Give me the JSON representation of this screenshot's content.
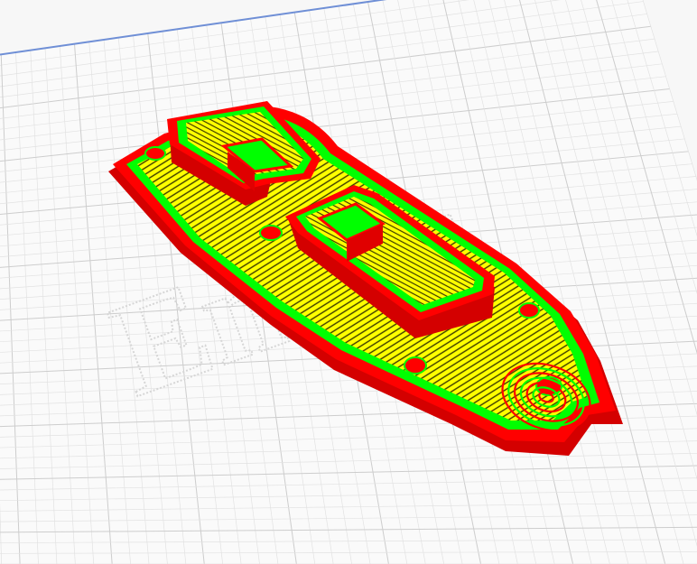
{
  "viewport": {
    "watermark_text": "Ender",
    "background": "#f7f7f7",
    "bed_color": "#fafafa",
    "grid_minor_color": "#e2e2e2",
    "grid_major_color": "#cdcdcd",
    "bed_edge_color": "#6f8fd6"
  },
  "model": {
    "perimeter_outer_color": "#ff0000",
    "perimeter_inner_color": "#00ff00",
    "infill_color": "#ffff00",
    "infill_line_color": "#3a3a00"
  }
}
